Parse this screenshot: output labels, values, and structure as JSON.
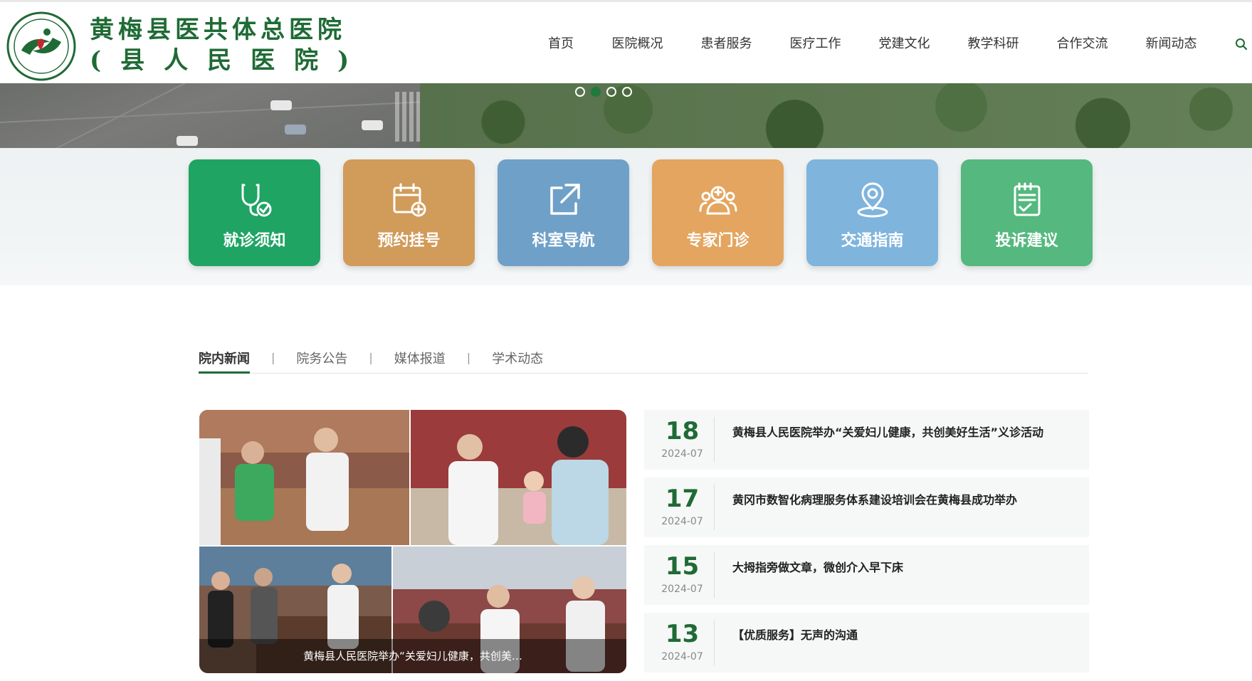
{
  "site": {
    "title_line1": "黄梅县医共体总医院",
    "title_line2": "(县人民医院)",
    "logo_ring_text": "黄梅县医共体总医院（县人民医院）"
  },
  "nav": {
    "items": [
      {
        "label": "首页"
      },
      {
        "label": "医院概况"
      },
      {
        "label": "患者服务"
      },
      {
        "label": "医疗工作"
      },
      {
        "label": "党建文化"
      },
      {
        "label": "教学科研"
      },
      {
        "label": "合作交流"
      },
      {
        "label": "新闻动态"
      }
    ],
    "search_icon": "search-icon"
  },
  "banner": {
    "dots": 4,
    "active_dot": 2
  },
  "quick_links": [
    {
      "label": "就诊须知",
      "icon": "stethoscope-icon",
      "color": "#1fa463"
    },
    {
      "label": "预约挂号",
      "icon": "calendar-plus-icon",
      "color": "#d19b5a"
    },
    {
      "label": "科室导航",
      "icon": "external-link-icon",
      "color": "#6fa0c8"
    },
    {
      "label": "专家门诊",
      "icon": "doctors-icon",
      "color": "#e3a55f"
    },
    {
      "label": "交通指南",
      "icon": "map-pin-icon",
      "color": "#7fb4dd"
    },
    {
      "label": "投诉建议",
      "icon": "clipboard-check-icon",
      "color": "#55b87e"
    }
  ],
  "news_tabs": [
    {
      "label": "院内新闻",
      "active": true
    },
    {
      "label": "院务公告",
      "active": false
    },
    {
      "label": "媒体报道",
      "active": false
    },
    {
      "label": "学术动态",
      "active": false
    }
  ],
  "tab_separator": "|",
  "featured": {
    "caption": "黄梅县人民医院举办“关爱妇儿健康，共创美…"
  },
  "news": [
    {
      "day": "18",
      "ym": "2024-07",
      "title": "黄梅县人民医院举办“关爱妇儿健康，共创美好生活”义诊活动"
    },
    {
      "day": "17",
      "ym": "2024-07",
      "title": "黄冈市数智化病理服务体系建设培训会在黄梅县成功举办"
    },
    {
      "day": "15",
      "ym": "2024-07",
      "title": "大拇指旁做文章，微创介入早下床"
    },
    {
      "day": "13",
      "ym": "2024-07",
      "title": "【优质服务】无声的沟通"
    }
  ]
}
